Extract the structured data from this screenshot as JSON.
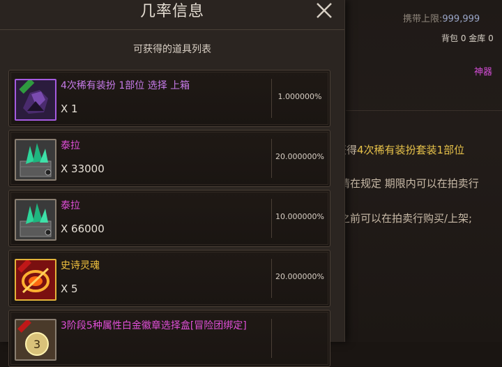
{
  "background": {
    "carry_limit_label": "携带上限:",
    "carry_limit_value": "999,999",
    "bag_info": "背包 0 金库 0",
    "artifact_label": "神器",
    "line1_prefix": "获得",
    "line1_highlight": "4次稀有装扮套装1部位",
    "line2": "请在规定 期限内可以在拍卖行",
    "line3": "之前可以在拍卖行购买/上架;"
  },
  "popup": {
    "title": "几率信息",
    "subtitle": "可获得的道具列表",
    "items": [
      {
        "name": "4次稀有装扮 1部位 选择 上箱",
        "qty": "X 1",
        "rate": "1.000000%",
        "rarity": "purple"
      },
      {
        "name": "泰拉",
        "qty": "X 33000",
        "rate": "20.000000%",
        "rarity": "magenta"
      },
      {
        "name": "泰拉",
        "qty": "X 66000",
        "rate": "10.000000%",
        "rarity": "magenta"
      },
      {
        "name": "史诗灵魂",
        "qty": "X 5",
        "rate": "20.000000%",
        "rarity": "gold"
      },
      {
        "name": "3阶段5种属性白金徽章选择盒[冒险团绑定]",
        "qty": "",
        "rate": "",
        "rarity": "magenta"
      }
    ]
  },
  "icons": {
    "close": "close-icon",
    "item_icons": [
      "costume-box-icon",
      "tera-crystal-icon",
      "tera-crystal-icon",
      "epic-soul-icon",
      "platinum-emblem-box-icon"
    ]
  },
  "colors": {
    "purple_rarity": "#c77be9",
    "magenta_rarity": "#e04fd8",
    "gold_rarity": "#f2c23e"
  }
}
